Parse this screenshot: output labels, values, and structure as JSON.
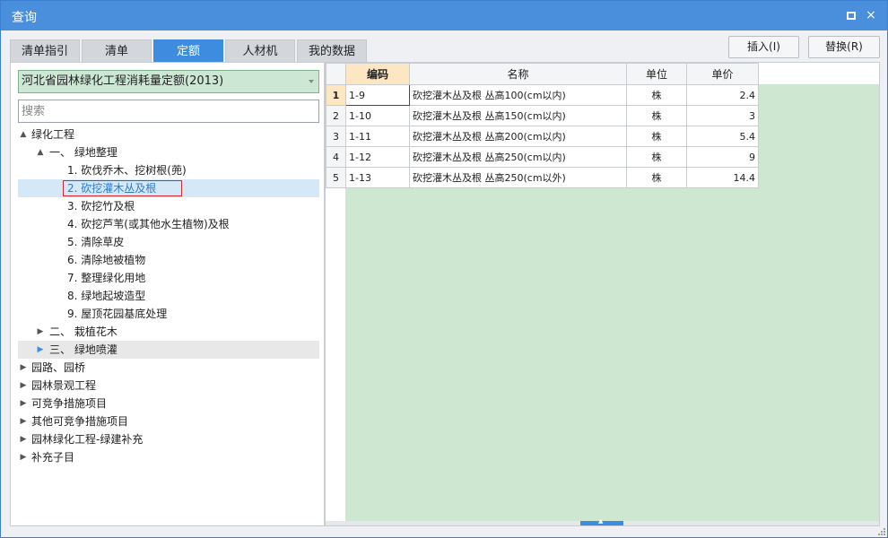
{
  "window": {
    "title": "查询",
    "maximize_icon": "maximize-icon",
    "close_glyph": "×"
  },
  "tabs": [
    {
      "label": "清单指引",
      "active": false
    },
    {
      "label": "清单",
      "active": false
    },
    {
      "label": "定额",
      "active": true
    },
    {
      "label": "人材机",
      "active": false
    },
    {
      "label": "我的数据",
      "active": false
    }
  ],
  "actions": {
    "insert_label": "插入(I)",
    "replace_label": "替换(R)"
  },
  "left": {
    "library_selected": "河北省园林绿化工程消耗量定额(2013)",
    "search_placeholder": "搜索",
    "tree": [
      {
        "label": "绿化工程",
        "level": 0,
        "toggle": "▲"
      },
      {
        "label": "一、  绿地整理",
        "level": 1,
        "toggle": "▲"
      },
      {
        "label": "1. 砍伐乔木、挖树根(蔸)",
        "level": 2,
        "toggle": ""
      },
      {
        "label": "2. 砍挖灌木丛及根",
        "level": 2,
        "toggle": "",
        "selected": true
      },
      {
        "label": "3. 砍挖竹及根",
        "level": 2,
        "toggle": ""
      },
      {
        "label": "4. 砍挖芦苇(或其他水生植物)及根",
        "level": 2,
        "toggle": ""
      },
      {
        "label": "5. 清除草皮",
        "level": 2,
        "toggle": ""
      },
      {
        "label": "6. 清除地被植物",
        "level": 2,
        "toggle": ""
      },
      {
        "label": "7. 整理绿化用地",
        "level": 2,
        "toggle": ""
      },
      {
        "label": "8. 绿地起坡造型",
        "level": 2,
        "toggle": ""
      },
      {
        "label": "9. 屋顶花园基底处理",
        "level": 2,
        "toggle": ""
      },
      {
        "label": "二、  栽植花木",
        "level": 1,
        "toggle": "▶"
      },
      {
        "label": "三、  绿地喷灌",
        "level": 1,
        "toggle": "▶",
        "hover": true
      },
      {
        "label": "园路、园桥",
        "level": 0,
        "toggle": "▶"
      },
      {
        "label": "园林景观工程",
        "level": 0,
        "toggle": "▶"
      },
      {
        "label": "可竞争措施项目",
        "level": 0,
        "toggle": "▶"
      },
      {
        "label": "其他可竞争措施项目",
        "level": 0,
        "toggle": "▶"
      },
      {
        "label": "园林绿化工程-绿建补充",
        "level": 0,
        "toggle": "▶"
      },
      {
        "label": "补充子目",
        "level": 0,
        "toggle": "▶"
      }
    ]
  },
  "grid": {
    "columns": [
      "编码",
      "名称",
      "单位",
      "单价"
    ],
    "rows": [
      {
        "num": "1",
        "code": "1-9",
        "name": "砍挖灌木丛及根 丛高100(cm以内)",
        "unit": "株",
        "price": "2.4"
      },
      {
        "num": "2",
        "code": "1-10",
        "name": "砍挖灌木丛及根 丛高150(cm以内)",
        "unit": "株",
        "price": "3"
      },
      {
        "num": "3",
        "code": "1-11",
        "name": "砍挖灌木丛及根 丛高200(cm以内)",
        "unit": "株",
        "price": "5.4"
      },
      {
        "num": "4",
        "code": "1-12",
        "name": "砍挖灌木丛及根 丛高250(cm以内)",
        "unit": "株",
        "price": "9"
      },
      {
        "num": "5",
        "code": "1-13",
        "name": "砍挖灌木丛及根 丛高250(cm以外)",
        "unit": "株",
        "price": "14.4"
      }
    ]
  },
  "colors": {
    "accent": "#3e8ce0",
    "titlebar": "#4a8fdb",
    "green_bg": "#cde7d1",
    "active_header": "#fde7c2",
    "selection_box": "#d9262b"
  }
}
